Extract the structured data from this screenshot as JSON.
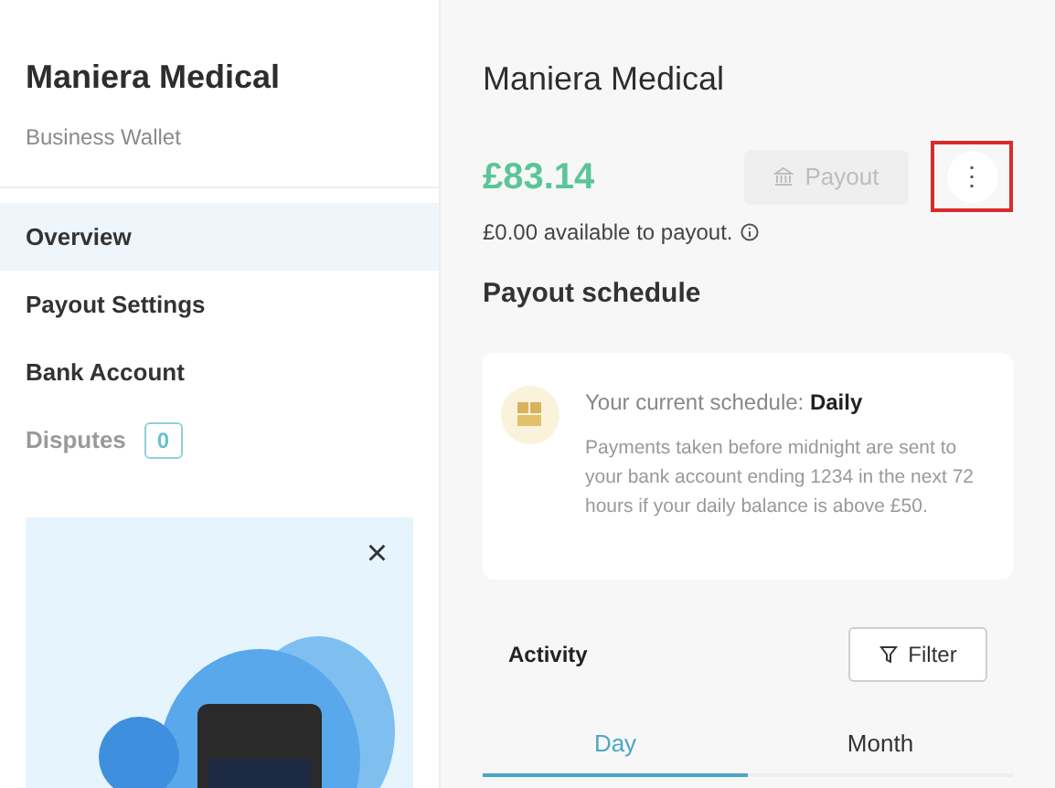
{
  "sidebar": {
    "title": "Maniera Medical",
    "subtitle": "Business Wallet",
    "items": [
      {
        "label": "Overview",
        "selected": true,
        "disabled": false
      },
      {
        "label": "Payout Settings",
        "selected": false,
        "disabled": false
      },
      {
        "label": "Bank Account",
        "selected": false,
        "disabled": false
      },
      {
        "label": "Disputes",
        "selected": false,
        "disabled": true,
        "badge": "0"
      }
    ],
    "promo": {
      "close": "×"
    }
  },
  "main": {
    "title": "Maniera Medical",
    "balance": "£83.14",
    "available": "£0.00 available to payout.",
    "payout_button": {
      "label": "Payout",
      "disabled": true
    },
    "more_button": {
      "label": "⋮",
      "highlighted": true
    },
    "schedule_heading": "Payout schedule",
    "schedule": {
      "label": "Your current schedule: ",
      "value": "Daily",
      "text": "Payments taken before midnight are sent to your bank account ending 1234 in the next 72 hours if your daily balance is above £50."
    },
    "activity": {
      "title": "Activity",
      "filter": "Filter",
      "tabs": [
        {
          "label": "Day",
          "selected": true
        },
        {
          "label": "Month",
          "selected": false
        }
      ]
    }
  }
}
